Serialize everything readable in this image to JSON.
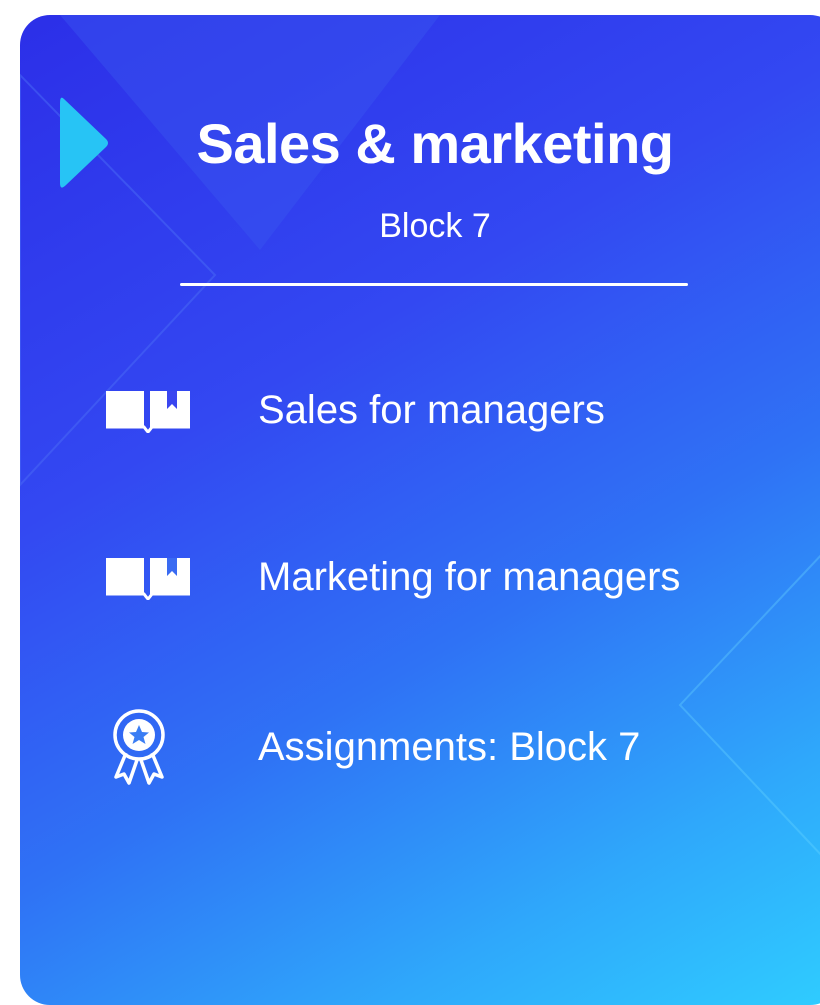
{
  "card": {
    "title": "Sales & marketing",
    "subtitle": "Block 7"
  },
  "items": [
    {
      "label": "Sales for managers",
      "icon": "open-book-icon"
    },
    {
      "label": "Marketing for managers",
      "icon": "open-book-icon"
    },
    {
      "label": "Assignments: Block 7",
      "icon": "award-badge-icon"
    }
  ],
  "colors": {
    "gradient_start": "#2c2fe8",
    "gradient_end": "#2fcdff",
    "accent_marker": "#27c4f5",
    "text": "#ffffff"
  }
}
